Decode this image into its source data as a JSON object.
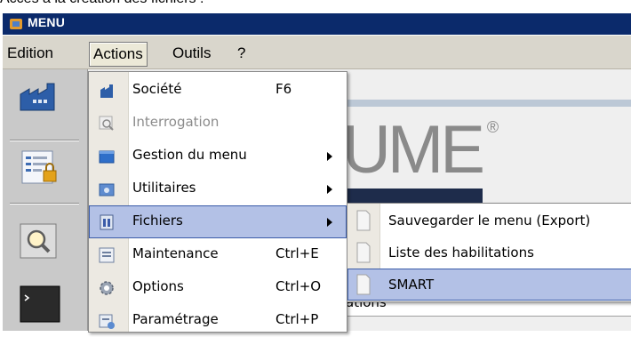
{
  "caption": "Accès à la création des fichiers :",
  "window": {
    "title": "MENU"
  },
  "menubar": {
    "items": [
      "Edition",
      "Actions",
      "Outils",
      "?"
    ],
    "active": "Actions"
  },
  "logo": {
    "text": "UME",
    "registered": "®"
  },
  "background_field": {
    "text": "ations"
  },
  "actions_menu": {
    "items": [
      {
        "label": "Société",
        "shortcut": "F6",
        "icon": "building-icon",
        "submenu": false,
        "disabled": false
      },
      {
        "label": "Interrogation",
        "shortcut": "",
        "icon": "search-icon",
        "submenu": false,
        "disabled": true
      },
      {
        "label": "Gestion du menu",
        "shortcut": "",
        "icon": "folder-icon",
        "submenu": true,
        "disabled": false
      },
      {
        "label": "Utilitaires",
        "shortcut": "",
        "icon": "tools-icon",
        "submenu": true,
        "disabled": false
      },
      {
        "label": "Fichiers",
        "shortcut": "",
        "icon": "cabinet-icon",
        "submenu": true,
        "disabled": false,
        "selected": true
      },
      {
        "label": "Maintenance",
        "shortcut": "Ctrl+E",
        "icon": "window-icon",
        "submenu": false,
        "disabled": false
      },
      {
        "label": "Options",
        "shortcut": "Ctrl+O",
        "icon": "gear-icon",
        "submenu": false,
        "disabled": false
      },
      {
        "label": "Paramétrage",
        "shortcut": "Ctrl+P",
        "icon": "settings-icon",
        "submenu": false,
        "disabled": false
      }
    ]
  },
  "fichiers_submenu": {
    "items": [
      {
        "label": "Sauvegarder le menu (Export)",
        "icon": "document-icon"
      },
      {
        "label": "Liste des habilitations",
        "icon": "document-icon"
      },
      {
        "label": "SMART",
        "icon": "document-icon",
        "selected": true
      }
    ]
  },
  "colors": {
    "titlebar": "#0b2a6b",
    "highlight": "#b3c1e6",
    "highlight_border": "#3b5ca8"
  }
}
